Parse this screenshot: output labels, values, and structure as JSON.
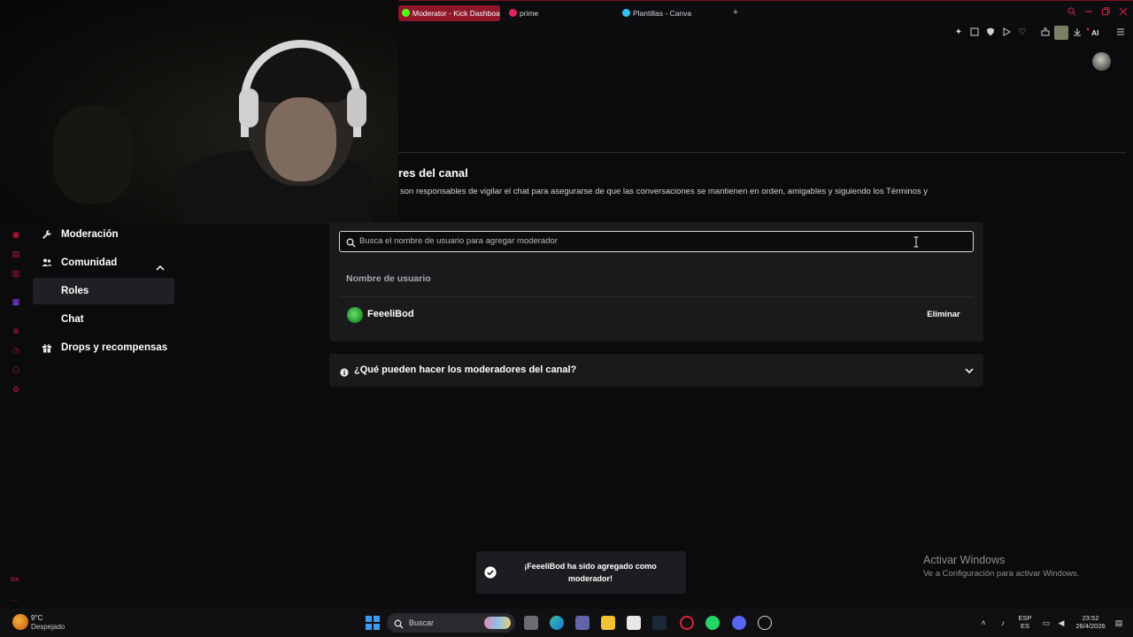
{
  "browser": {
    "tabs": [
      {
        "label": "Moderator - Kick Dashboard",
        "active": true,
        "favicon_color": "#53fc18"
      },
      {
        "label": "prime",
        "active": false,
        "favicon_color": "#e0245e"
      },
      {
        "label": "Plantillas - Canva",
        "active": false,
        "favicon_color": "#35c3f3"
      }
    ],
    "toolbar": {
      "ai_label": "AI"
    }
  },
  "sidebar": {
    "items": [
      {
        "label": "Moderación",
        "icon": "wrench-icon"
      },
      {
        "label": "Comunidad",
        "icon": "users-icon",
        "expanded": true
      },
      {
        "label": "Roles",
        "selected": true
      },
      {
        "label": "Chat"
      },
      {
        "label": "Drops y recompensas",
        "icon": "gift-icon"
      }
    ]
  },
  "main": {
    "section_title": "res del canal",
    "section_description": "son responsables de vigilar el chat para asegurarse de que las conversaciones se mantienen en orden, amigables y siguiendo los Términos y",
    "search_placeholder": "Busca el nombre de usuario para agregar moderador",
    "table": {
      "column_header": "Nombre de usuario",
      "rows": [
        {
          "username": "FeeeliBod",
          "action": "Eliminar"
        }
      ]
    },
    "faq_question": "¿Qué pueden hacer los moderadores del canal?"
  },
  "toast": {
    "message": "¡FeeeliBod ha sido agregado como moderador!"
  },
  "watermark": {
    "title": "Activar Windows",
    "subtitle": "Ve a Configuración para activar Windows."
  },
  "taskbar": {
    "weather_temp": "9°C",
    "weather_desc": "Despejado",
    "search_label": "Buscar",
    "lang_top": "ESP",
    "lang_bottom": "ES",
    "time": "23:52",
    "date": "26/4/2026"
  },
  "colors": {
    "accent_red": "#c2183a",
    "active_tab": "#8e1628",
    "card_bg": "#1a1a1d",
    "kick_green": "#53fc18"
  }
}
